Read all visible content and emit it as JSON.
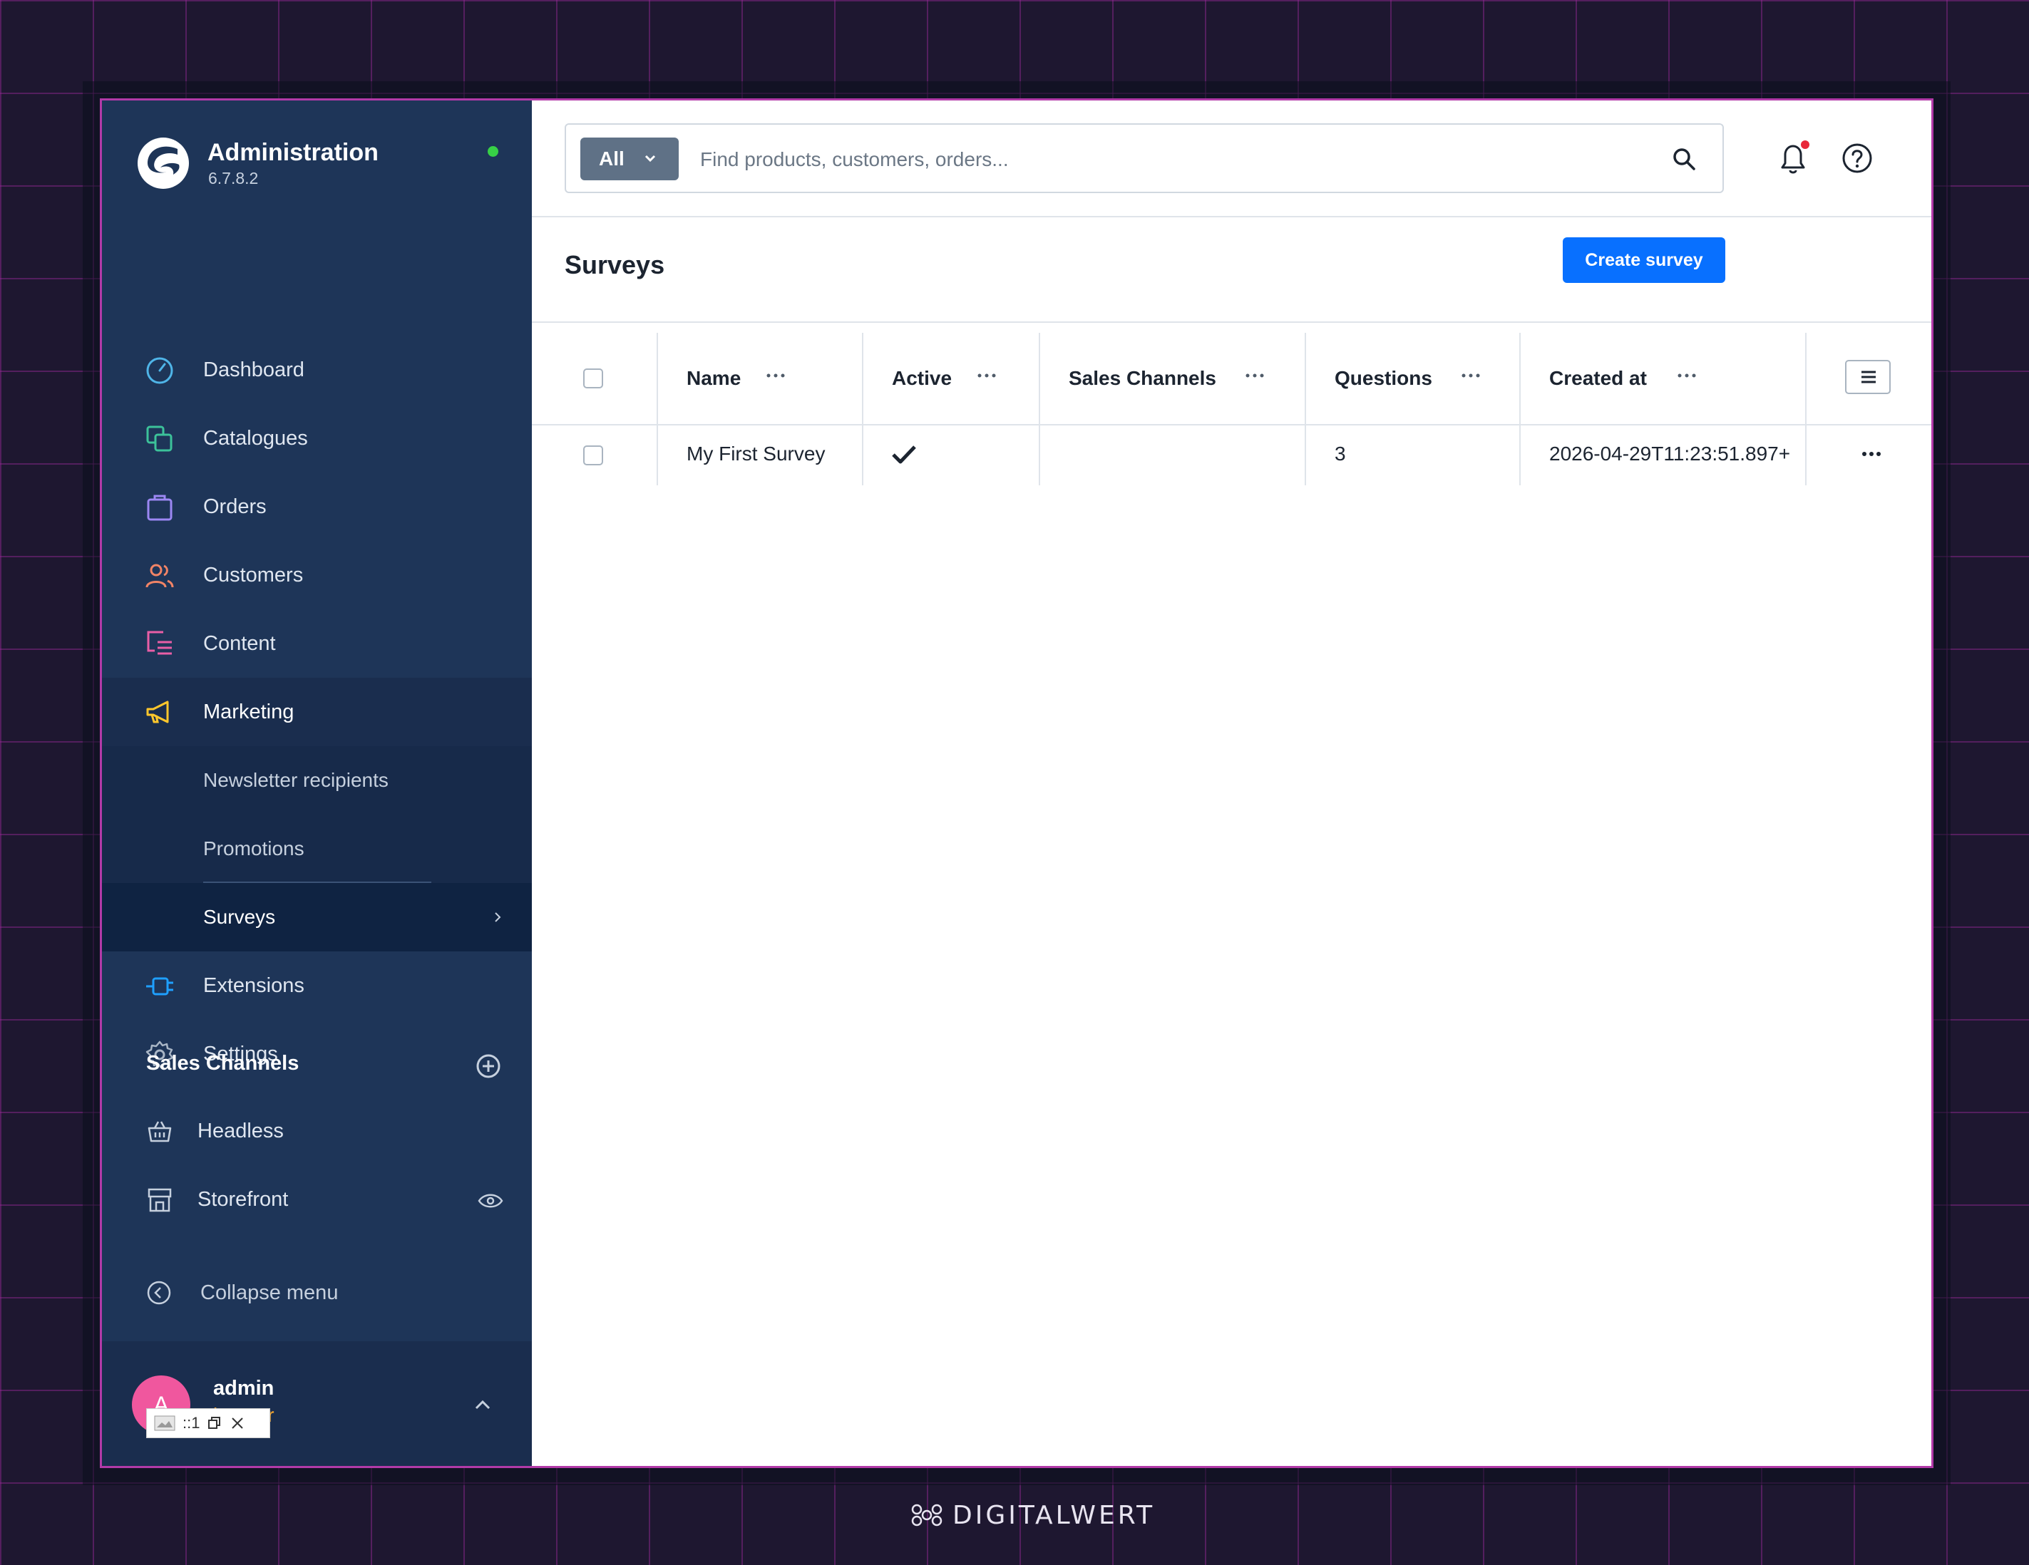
{
  "brand": {
    "title": "Administration",
    "version": "6.7.8.2"
  },
  "nav": {
    "items": [
      {
        "label": "Dashboard",
        "icon": "dashboard-icon",
        "color": "#4fb5e8"
      },
      {
        "label": "Catalogues",
        "icon": "catalogues-icon",
        "color": "#3cc29a"
      },
      {
        "label": "Orders",
        "icon": "orders-icon",
        "color": "#9c87f3"
      },
      {
        "label": "Customers",
        "icon": "customers-icon",
        "color": "#f28466"
      },
      {
        "label": "Content",
        "icon": "content-icon",
        "color": "#e95ea6"
      },
      {
        "label": "Marketing",
        "icon": "marketing-icon",
        "color": "#ffc72c"
      }
    ],
    "marketing_sub": [
      "Newsletter recipients",
      "Promotions",
      "Surveys"
    ],
    "items_after": [
      {
        "label": "Extensions",
        "icon": "extensions-icon",
        "color": "#1fa0ff"
      },
      {
        "label": "Settings",
        "icon": "settings-icon",
        "color": "#a9b6c6"
      }
    ]
  },
  "sales_channels": {
    "title": "Sales Channels",
    "items": [
      {
        "label": "Headless",
        "icon": "basket-icon"
      },
      {
        "label": "Storefront",
        "icon": "storefront-icon"
      }
    ]
  },
  "collapse_label": "Collapse menu",
  "user": {
    "name": "admin",
    "role": "istrator",
    "initial": "A",
    "overlay_text": "::1"
  },
  "search": {
    "type": "All",
    "placeholder": "Find products, customers, orders..."
  },
  "page": {
    "title": "Surveys",
    "create_label": "Create survey"
  },
  "table": {
    "columns": [
      "Name",
      "Active",
      "Sales Channels",
      "Questions",
      "Created at"
    ],
    "rows": [
      {
        "name": "My First Survey",
        "active": true,
        "sales_channels": "",
        "questions": "3",
        "created_at": "2026-04-29T11:23:51.897+"
      }
    ]
  },
  "footer": {
    "brand": "DIGITALWERT"
  },
  "colors": {
    "sidebar": "#1e3558",
    "accent": "#0870ff",
    "status": "#37d046"
  }
}
